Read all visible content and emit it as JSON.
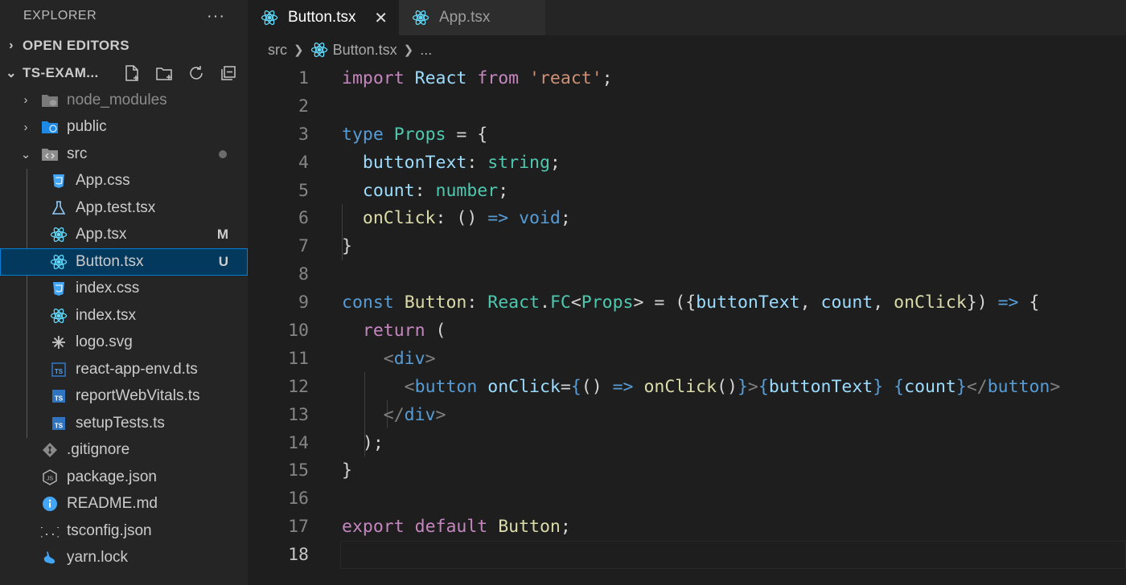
{
  "sidebar": {
    "title": "EXPLORER",
    "more": "···",
    "open_editors": "OPEN EDITORS",
    "project": "TS-EXAM...",
    "items": [
      {
        "label": "node_modules",
        "icon": "folder-node-icon",
        "badge": ""
      },
      {
        "label": "public",
        "icon": "folder-public-icon",
        "badge": ""
      },
      {
        "label": "src",
        "icon": "folder-src-icon",
        "badge": ""
      },
      {
        "label": "App.css",
        "icon": "css-file-icon",
        "badge": ""
      },
      {
        "label": "App.test.tsx",
        "icon": "test-flask-icon",
        "badge": ""
      },
      {
        "label": "App.tsx",
        "icon": "react-icon",
        "badge": "M"
      },
      {
        "label": "Button.tsx",
        "icon": "react-icon",
        "badge": "U"
      },
      {
        "label": "index.css",
        "icon": "css-file-icon",
        "badge": ""
      },
      {
        "label": "index.tsx",
        "icon": "react-icon",
        "badge": ""
      },
      {
        "label": "logo.svg",
        "icon": "svg-file-icon",
        "badge": ""
      },
      {
        "label": "react-app-env.d.ts",
        "icon": "ts-def-file-icon",
        "badge": ""
      },
      {
        "label": "reportWebVitals.ts",
        "icon": "ts-file-icon",
        "badge": ""
      },
      {
        "label": "setupTests.ts",
        "icon": "ts-file-icon",
        "badge": ""
      },
      {
        "label": ".gitignore",
        "icon": "git-icon",
        "badge": ""
      },
      {
        "label": "package.json",
        "icon": "js-file-icon",
        "badge": ""
      },
      {
        "label": "README.md",
        "icon": "info-icon",
        "badge": ""
      },
      {
        "label": "tsconfig.json",
        "icon": "json-braces-icon",
        "badge": ""
      },
      {
        "label": "yarn.lock",
        "icon": "yarn-icon",
        "badge": ""
      }
    ]
  },
  "tabs": [
    {
      "label": "Button.tsx",
      "active": true
    },
    {
      "label": "App.tsx",
      "active": false
    }
  ],
  "breadcrumb": {
    "folder": "src",
    "file": "Button.tsx",
    "more": "..."
  },
  "editor": {
    "line_numbers": [
      "1",
      "2",
      "3",
      "4",
      "5",
      "6",
      "7",
      "8",
      "9",
      "10",
      "11",
      "12",
      "13",
      "14",
      "15",
      "16",
      "17",
      "18"
    ],
    "current_line": 18
  },
  "colors": {
    "accent": "#007fd4",
    "selection": "#04395e",
    "react": "#61dafb",
    "css": "#42a5f5",
    "ts": "#2f74c0"
  }
}
